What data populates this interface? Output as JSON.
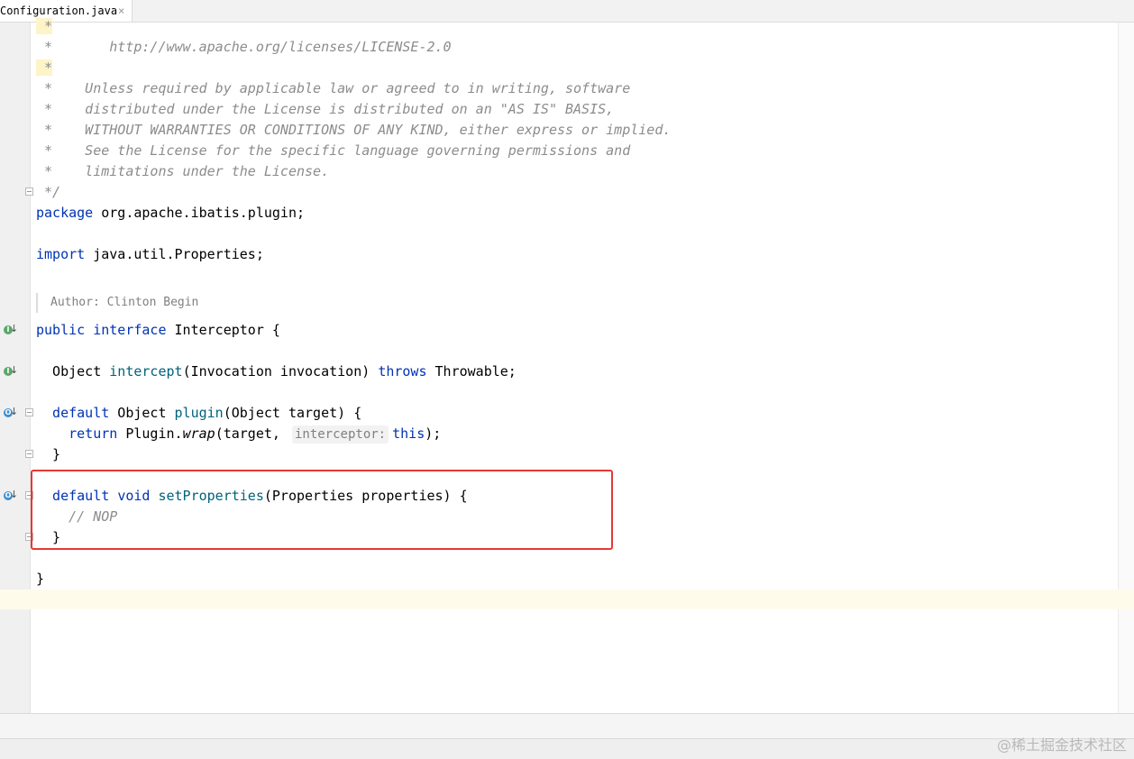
{
  "tab": {
    "label": "Configuration.java",
    "close": "×"
  },
  "code": {
    "l_star1": " *",
    "l_url": " *       http://www.apache.org/licenses/LICENSE-2.0",
    "l_star2": " *",
    "l_unless": " *    Unless required by applicable law or agreed to in writing, software",
    "l_distributed": " *    distributed under the License is distributed on an \"AS IS\" BASIS,",
    "l_warranties": " *    WITHOUT WARRANTIES OR CONDITIONS OF ANY KIND, either express or implied.",
    "l_see": " *    See the License for the specific language governing permissions and",
    "l_limitations": " *    limitations under the License.",
    "l_end": " */",
    "pkg_kw": "package",
    "pkg_name": " org.apache.ibatis.plugin;",
    "imp_kw": "import",
    "imp_name": " java.util.Properties;",
    "author_label": "Author:",
    "author_name": " Clinton Begin",
    "iface_public": "public",
    "iface_interface": "interface",
    "iface_name": " Interceptor ",
    "brace_open": "{",
    "m1_ret": "  Object ",
    "m1_name": "intercept",
    "m1_params": "(Invocation invocation) ",
    "m1_throws": "throws",
    "m1_exc": " Throwable;",
    "m2_default": "  default",
    "m2_ret": " Object ",
    "m2_name": "plugin",
    "m2_params": "(Object target) ",
    "m2_return": "    return",
    "m2_call": " Plugin.",
    "m2_wrap": "wrap",
    "m2_args": "(target,",
    "m2_hint": "interceptor:",
    "m2_this": "this",
    "m2_end": ");",
    "m2_close": "  }",
    "m3_default": "  default",
    "m3_void": "void",
    "m3_name": "setProperties",
    "m3_params": "(Properties properties) ",
    "m3_comment": "    // NOP",
    "m3_close": "  }",
    "iface_close": "}"
  },
  "gutter_icons": {
    "impl_glyph": "I",
    "over_glyph": "O",
    "arrow_glyph": "↓"
  },
  "watermark": "@稀土掘金技术社区",
  "colors": {
    "keyword": "#0033b3",
    "method": "#00627a",
    "comment": "#8c8c8c",
    "highlight_box": "#e53935"
  }
}
